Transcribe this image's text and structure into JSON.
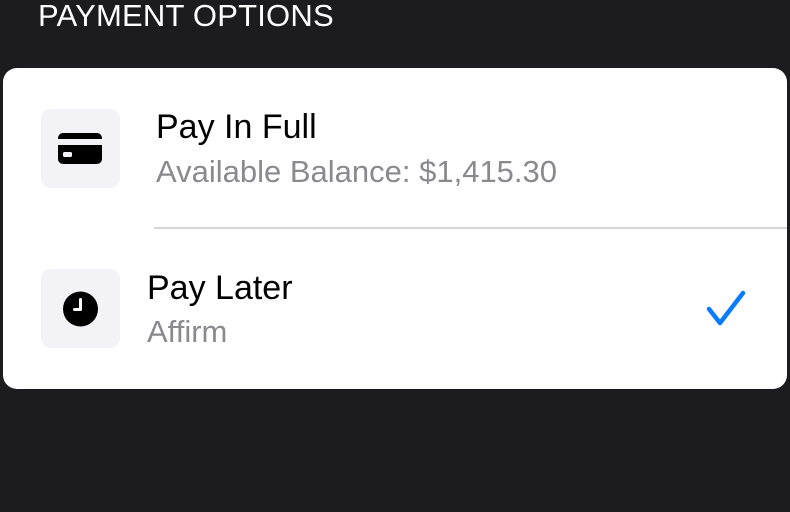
{
  "header": {
    "title": "PAYMENT OPTIONS"
  },
  "options": [
    {
      "title": "Pay In Full",
      "subtitle": "Available Balance: $1,415.30",
      "icon": "credit-card-icon",
      "selected": false
    },
    {
      "title": "Pay Later",
      "subtitle": "Affirm",
      "icon": "clock-icon",
      "selected": true
    }
  ],
  "colors": {
    "background": "#1c1c1e",
    "card": "#ffffff",
    "icon_tile": "#f2f2f7",
    "subtitle": "#8a8a8e",
    "accent": "#0a7aff",
    "divider": "#d6d6d9"
  }
}
